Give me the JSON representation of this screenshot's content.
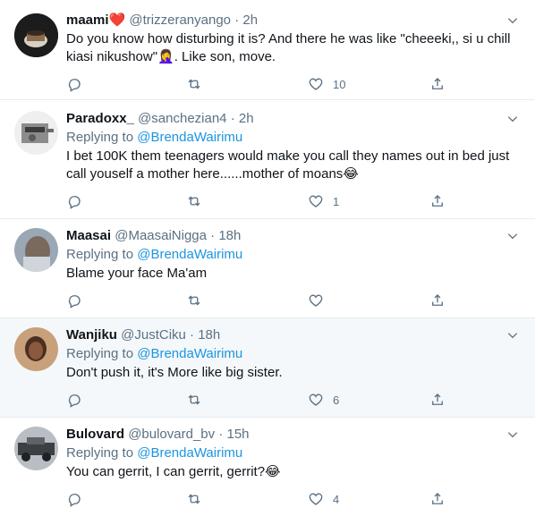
{
  "tweets": [
    {
      "name": "maami",
      "name_suffix": "❤️",
      "handle": "@trizzeranyango",
      "time": "2h",
      "replying_to": "",
      "body": "Do you know how disturbing it is? And there he was like \"cheeeki,, si u chill kiasi nikushow\"🤦‍♀️. Like son, move.",
      "likes": "10",
      "retweets": "",
      "replies": "",
      "avatar_colors": [
        "#1a1a1a",
        "#6b5a48"
      ]
    },
    {
      "name": "Paradoxx_",
      "handle": "@sanchezian4",
      "time": "2h",
      "replying_prefix": "Replying to ",
      "replying_to": "@BrendaWairimu",
      "body": "I bet 100K them teenagers would make you call they names out in bed just call youself a mother here......mother of moans😂",
      "likes": "1",
      "avatar_colors": [
        "#d9d9d9",
        "#6e6e6e"
      ]
    },
    {
      "name": "Maasai",
      "handle": "@MaasaiNigga",
      "time": "18h",
      "replying_prefix": "Replying to ",
      "replying_to": "@BrendaWairimu",
      "body": "Blame your face Ma'am",
      "likes": "",
      "avatar_colors": [
        "#a7b4c4",
        "#7b6a5e"
      ]
    },
    {
      "name": "Wanjiku",
      "handle": "@JustCiku",
      "time": "18h",
      "replying_prefix": "Replying to ",
      "replying_to": "@BrendaWairimu",
      "body": "Don't push it, it's More like big sister.",
      "likes": "6",
      "avatar_colors": [
        "#c9a27b",
        "#4a2f22"
      ]
    },
    {
      "name": "Bulovard",
      "handle": "@bulovard_bv",
      "time": "15h",
      "replying_prefix": "Replying to ",
      "replying_to": "@BrendaWairimu",
      "body": "You can gerrit, I can gerrit, gerrit?😂",
      "likes": "4",
      "avatar_colors": [
        "#9aa0a6",
        "#3c4043"
      ]
    }
  ],
  "icons": {
    "reply": "reply-icon",
    "retweet": "retweet-icon",
    "like": "heart-icon",
    "share": "share-icon",
    "more": "chevron-down-icon"
  },
  "colors": {
    "mention": "#1b95e0",
    "muted": "#5b7083",
    "highlight_bg": "#f5f8fa",
    "divider": "#e6ecf0"
  }
}
